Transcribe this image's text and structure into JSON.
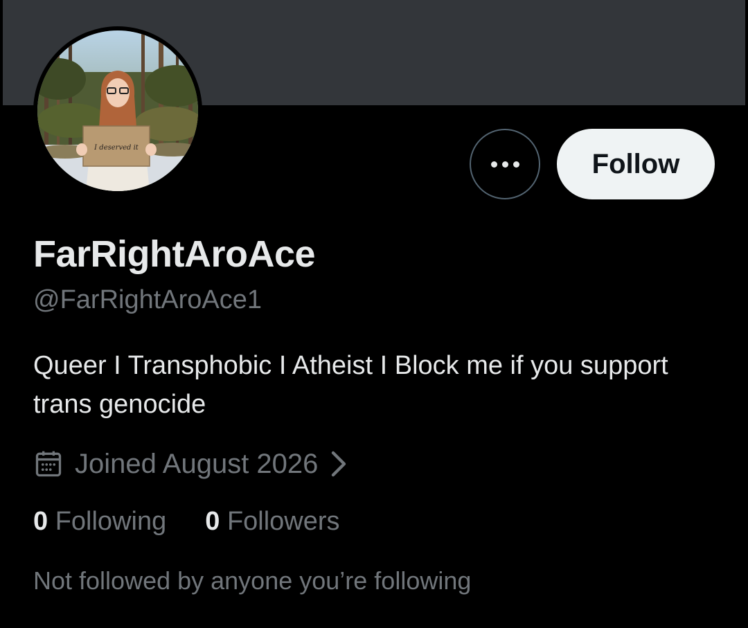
{
  "profile": {
    "display_name": "FarRightAroAce",
    "handle": "@FarRightAroAce1",
    "bio": "Queer I Transphobic I Atheist I Block me if you support trans genocide",
    "joined": "Joined August 2026",
    "avatar_sign_text": "I deserved it"
  },
  "actions": {
    "follow_label": "Follow",
    "more_icon": "more-horizontal-icon"
  },
  "stats": {
    "following_count": "0",
    "following_label": "Following",
    "followers_count": "0",
    "followers_label": "Followers"
  },
  "social_context": "Not followed by anyone you’re following",
  "icons": {
    "joined_icon": "calendar-icon",
    "joined_chevron": "chevron-right-icon"
  },
  "colors": {
    "background": "#000000",
    "banner": "#33363a",
    "primary_text": "#e7e9ea",
    "secondary_text": "#71767b",
    "follow_button_bg": "#eff3f4"
  }
}
